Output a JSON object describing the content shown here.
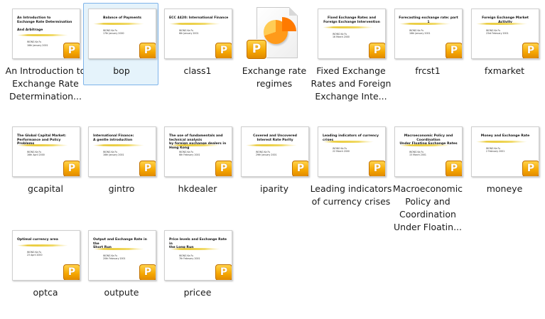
{
  "files": [
    {
      "id": "intro",
      "name": "An Introduction to Exchange Rate Determination...",
      "slide_title": "An Introduction to\nExchange Rate Determination\n\nAnd Arbitrage",
      "align": "left",
      "author": "WONG Ka Fu\n16th January 2001",
      "col": 0,
      "row": 0,
      "selected": false
    },
    {
      "id": "bop",
      "name": "bop",
      "slide_title": "Balance of Payments",
      "align": "center",
      "author": "WONG Ka Fu\n17th January 2000",
      "col": 1,
      "row": 0,
      "selected": true
    },
    {
      "id": "class1",
      "name": "class1",
      "slide_title": "ECC 4420: International Finance",
      "align": "left",
      "author": "WONG Ka Fu\n6th January 2001",
      "col": 2,
      "row": 0,
      "selected": false
    },
    {
      "id": "regimes",
      "name": "Exchange rate regimes",
      "icon": "pptx-file-icon",
      "col": 3,
      "row": 0,
      "selected": false
    },
    {
      "id": "fixed",
      "name": "Fixed Exchange Rates and Foreign Exchange Inte...",
      "slide_title": "Fixed Exchange Rates and\nForeign Exchange Intervention",
      "align": "center",
      "author": "WONG Ka Fu\n16 March 2000",
      "col": 4,
      "row": 0,
      "selected": false
    },
    {
      "id": "frcst1",
      "name": "frcst1",
      "slide_title": "Forecasting exchange rate: part 1",
      "align": "center",
      "author": "WONG Ka Fu\n16th January 2001",
      "col": 5,
      "row": 0,
      "selected": false
    },
    {
      "id": "fxmarket",
      "name": "fxmarket",
      "slide_title": "Foreign Exchange Market Activity",
      "align": "center",
      "author": "WONG Ka Fu\n23rd February 2001",
      "col": 6,
      "row": 0,
      "selected": false
    },
    {
      "id": "gcapital",
      "name": "gcapital",
      "slide_title": "The Global Capital Market:\nPerformance and Policy Problems",
      "align": "left",
      "author": "WONG Ka Fu\n16th April 2000",
      "col": 0,
      "row": 1,
      "selected": false
    },
    {
      "id": "gintro",
      "name": "gintro",
      "slide_title": "International Finance:\nA gentle introduction",
      "align": "left",
      "author": "WONG Ka Fu\n16th January 2001",
      "col": 1,
      "row": 1,
      "selected": false
    },
    {
      "id": "hkdealer",
      "name": "hkdealer",
      "slide_title": "The use of fundamentals and technical analysis\nby foreign exchange dealers in Hong Kong",
      "align": "left",
      "author": "WONG Ka Fu\n6th February 2001",
      "col": 2,
      "row": 1,
      "selected": false
    },
    {
      "id": "iparity",
      "name": "iparity",
      "slide_title": "Covered and Uncovered\nInterest Rate Parity",
      "align": "center",
      "author": "WONG Ka Fu\n29th January 2001",
      "col": 3,
      "row": 1,
      "selected": false
    },
    {
      "id": "leading",
      "name": "Leading indicators of currency crises",
      "slide_title": "Leading indicators of currency crises",
      "align": "left",
      "author": "WONG Ka Fu\n22 March 2000",
      "col": 4,
      "row": 1,
      "selected": false
    },
    {
      "id": "macro",
      "name": "Macroeconomic Policy and Coordination Under Floatin...",
      "slide_title": "Macroeconomic Policy and Coordination\nUnder Floating Exchange Rates",
      "align": "center",
      "author": "WONG Ka Fu\n15 March 2001",
      "col": 5,
      "row": 1,
      "selected": false
    },
    {
      "id": "moneye",
      "name": "moneye",
      "slide_title": "Money and Exchange Rate",
      "align": "center",
      "author": "WONG Ka Fu\n2 February 2001",
      "col": 6,
      "row": 1,
      "selected": false
    },
    {
      "id": "optca",
      "name": "optca",
      "slide_title": "Optimal currency area",
      "align": "left",
      "author": "WONG Ka Fu\n23 April 2000",
      "col": 0,
      "row": 2,
      "selected": false
    },
    {
      "id": "outpute",
      "name": "outpute",
      "slide_title": "Output and Exchange Rate in the\nShort Run",
      "align": "left",
      "author": "WONG Ka Fu\n20th February 2001",
      "col": 1,
      "row": 2,
      "selected": false
    },
    {
      "id": "pricee",
      "name": "pricee",
      "slide_title": "Price levels and Exchange Rate in\nthe Long Run",
      "align": "left",
      "author": "WONG Ka Fu\n7th February 2001",
      "col": 2,
      "row": 2,
      "selected": false
    }
  ],
  "badge_letter": "P",
  "colors": {
    "badge": "#f5a600",
    "selection_bg": "#e5f3fb",
    "selection_border": "#7eb4ea",
    "swoosh": "#e8c830"
  }
}
